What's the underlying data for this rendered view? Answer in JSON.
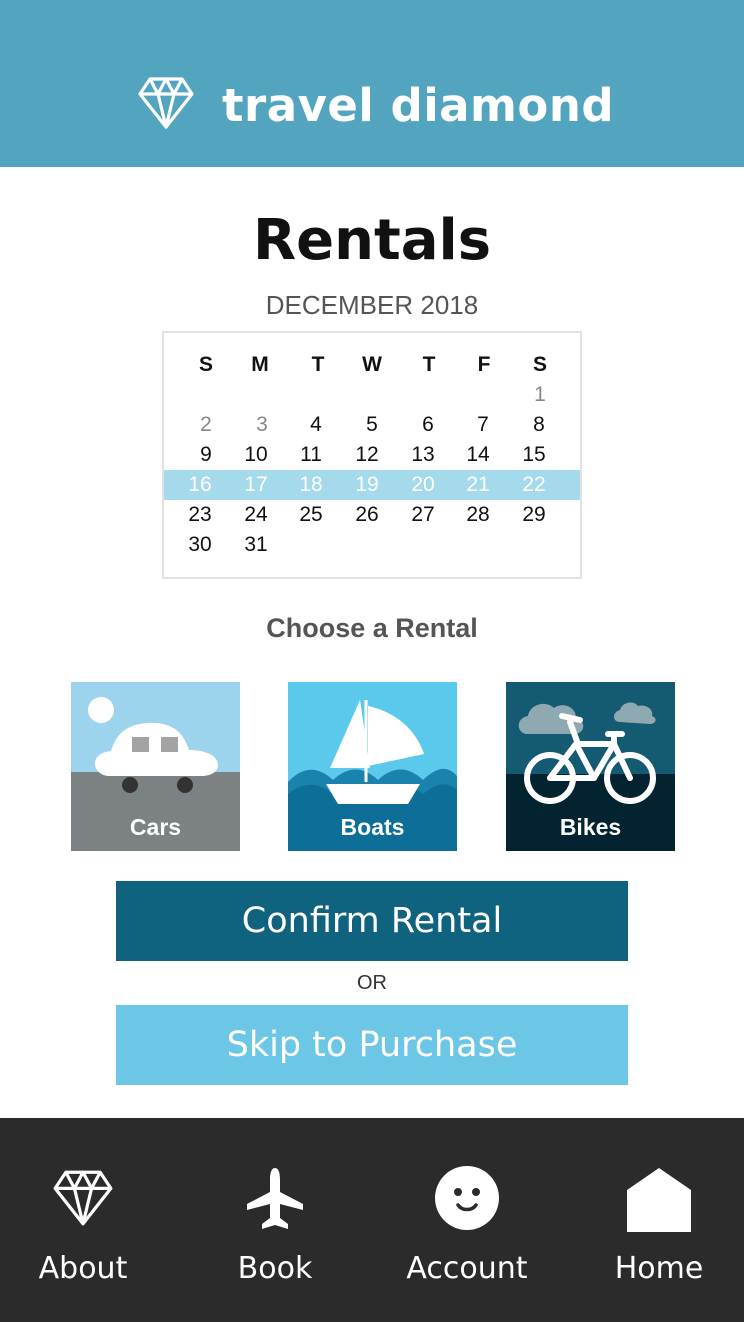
{
  "colors": {
    "header_bg": "#53a5bf",
    "nav_bg": "#2b2b2b",
    "confirm_bg": "#10637f",
    "skip_bg": "#6cc6e5",
    "selected_week": "#a5d9ec"
  },
  "header": {
    "brand_name": "travel diamond",
    "logo_icon": "diamond-icon"
  },
  "page": {
    "title": "Rentals"
  },
  "calendar": {
    "month": "DECEMBER 2018",
    "weekdays": [
      "S",
      "M",
      "T",
      "W",
      "T",
      "F",
      "S"
    ],
    "weeks": [
      [
        "",
        "",
        "",
        "",
        "",
        "",
        "1"
      ],
      [
        "2",
        "3",
        "4",
        "5",
        "6",
        "7",
        "8"
      ],
      [
        "9",
        "10",
        "11",
        "12",
        "13",
        "14",
        "15"
      ],
      [
        "16",
        "17",
        "18",
        "19",
        "20",
        "21",
        "22"
      ],
      [
        "23",
        "24",
        "25",
        "26",
        "27",
        "28",
        "29"
      ],
      [
        "30",
        "31",
        "",
        "",
        "",
        "",
        ""
      ]
    ],
    "selected_week_index": 3
  },
  "rentals": {
    "heading": "Choose a Rental",
    "options": [
      {
        "label": "Cars",
        "icon": "car-icon"
      },
      {
        "label": "Boats",
        "icon": "sailboat-icon"
      },
      {
        "label": "Bikes",
        "icon": "bicycle-icon"
      }
    ]
  },
  "actions": {
    "confirm_label": "Confirm Rental",
    "or_label": "OR",
    "skip_label": "Skip to Purchase"
  },
  "nav": {
    "items": [
      {
        "label": "About",
        "icon": "diamond-icon"
      },
      {
        "label": "Book",
        "icon": "airplane-icon"
      },
      {
        "label": "Account",
        "icon": "smiley-icon"
      },
      {
        "label": "Home",
        "icon": "house-icon"
      }
    ]
  }
}
